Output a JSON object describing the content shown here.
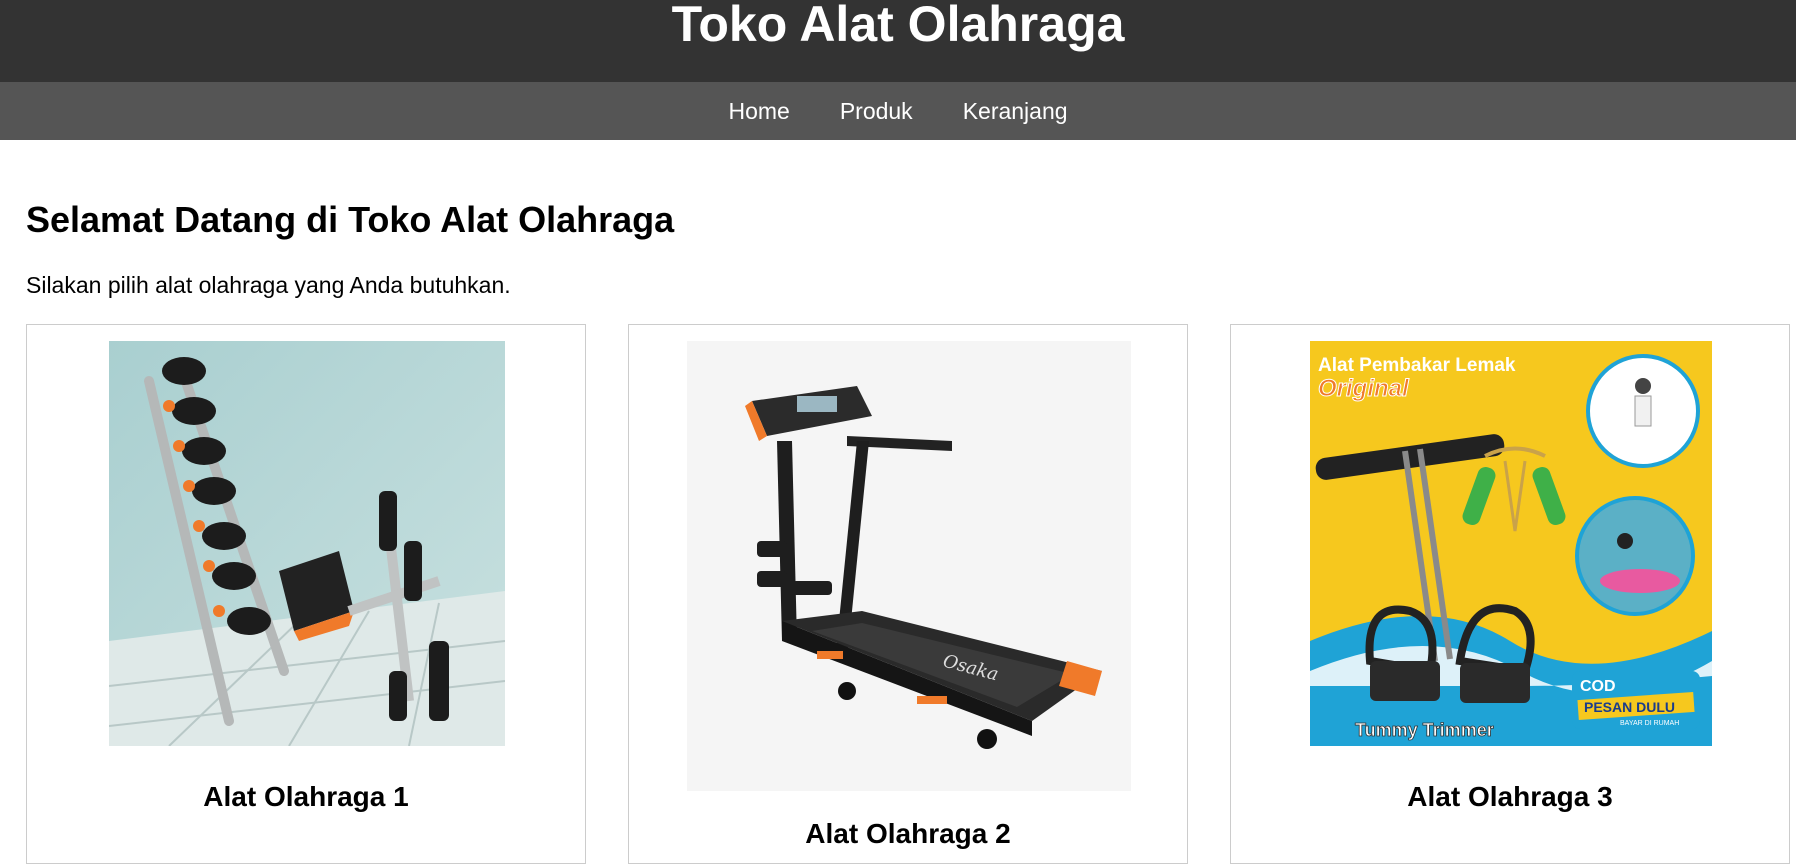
{
  "header": {
    "title": "Toko Alat Olahraga"
  },
  "nav": {
    "items": [
      {
        "label": "Home"
      },
      {
        "label": "Produk"
      },
      {
        "label": "Keranjang"
      }
    ]
  },
  "main": {
    "heading": "Selamat Datang di Toko Alat Olahraga",
    "intro": "Silakan pilih alat olahraga yang Anda butuhkan.",
    "products": [
      {
        "name": "Alat Olahraga 1"
      },
      {
        "name": "Alat Olahraga 2"
      },
      {
        "name": "Alat Olahraga 3"
      }
    ],
    "product3_image_text": {
      "headline": "Alat Pembakar Lemak",
      "sub": "Original",
      "badge_top": "COD",
      "badge_main": "PESAN DULU",
      "badge_sub": "BAYAR DI RUMAH",
      "footer": "Tummy Trimmer"
    },
    "product2_brand": "Osaka"
  },
  "colors": {
    "header_bg": "#333333",
    "nav_bg": "#555555",
    "card_border": "#cccccc",
    "accent_orange": "#f07a2a",
    "yellow_bg": "#f6c81e"
  }
}
